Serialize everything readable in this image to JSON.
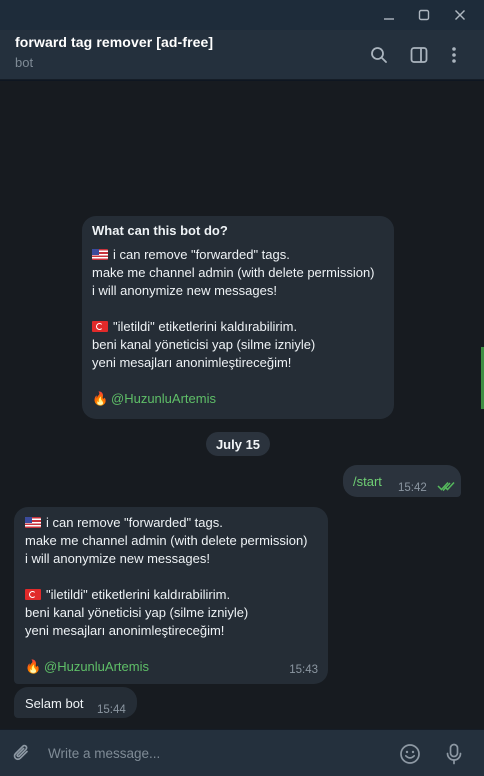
{
  "window": {
    "controls": [
      {
        "icon": "minimize-icon"
      },
      {
        "icon": "maximize-icon"
      },
      {
        "icon": "close-icon"
      }
    ]
  },
  "header": {
    "title": "forward tag remover [ad-free]",
    "subtitle": "bot",
    "icons": [
      "search-icon",
      "sidebar-toggle-icon",
      "more-vertical-icon"
    ]
  },
  "intro_card": {
    "heading": "What can this bot do?",
    "en_line1": "i can remove \"forwarded\" tags.",
    "en_line2": "make me channel admin (with delete permission)",
    "en_line3": "i will anonymize new messages!",
    "tr_line1": "\"iletildi\" etiketlerini kaldırabilirim.",
    "tr_line2": "beni kanal yöneticisi yap (silme izniyle)",
    "tr_line3": "yeni mesajları anonimleştireceğim!",
    "fire_emoji": "🔥",
    "username": "@HuzunluArtemis"
  },
  "date_separator": "July 15",
  "outgoing_message": {
    "text": "/start",
    "time": "15:42",
    "status": "read"
  },
  "bot_reply": {
    "en_line1": "i can remove \"forwarded\" tags.",
    "en_line2": "make me channel admin (with delete permission)",
    "en_line3": "i will anonymize new messages!",
    "tr_line1": "\"iletildi\" etiketlerini kaldırabilirim.",
    "tr_line2": "beni kanal yöneticisi yap (silme izniyle)",
    "tr_line3": "yeni mesajları anonimleştireceğim!",
    "fire_emoji": "🔥",
    "username": "@HuzunluArtemis",
    "time": "15:43"
  },
  "incoming_message": {
    "text": "Selam bot",
    "time": "15:44"
  },
  "composer": {
    "placeholder": "Write a message..."
  },
  "colors": {
    "accent_green": "#5fbf68",
    "header_bg": "#24303d",
    "chat_bg": "#171b20",
    "bubble_bg": "#252d36"
  }
}
